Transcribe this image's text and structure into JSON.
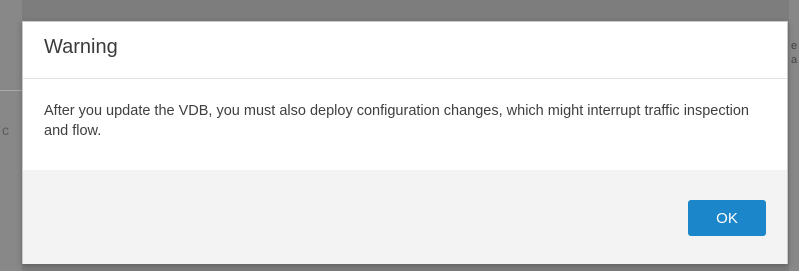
{
  "dialog": {
    "title": "Warning",
    "message": "After you update the VDB, you must also deploy configuration changes, which might interrupt traffic inspection and flow.",
    "ok_label": "OK"
  },
  "background": {
    "left_fragment": "c",
    "right_fragment_1": "e",
    "right_fragment_2": "a"
  },
  "colors": {
    "overlay": "#7d7d7d",
    "dialog_bg": "#ffffff",
    "footer_bg": "#f3f3f3",
    "primary_button": "#1b86c9"
  }
}
